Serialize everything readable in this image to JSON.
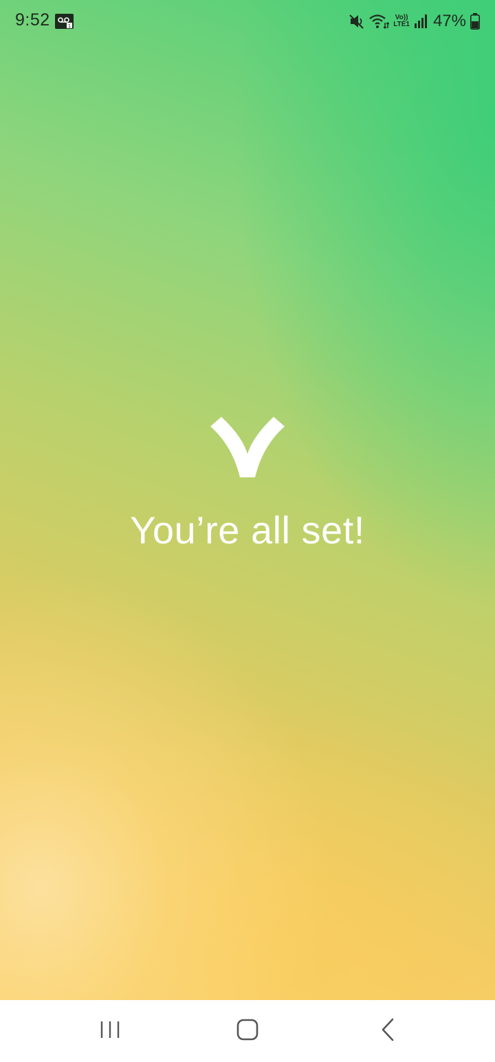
{
  "status_bar": {
    "time": "9:52",
    "volte_top": "Vo))",
    "volte_bottom": "LTE1",
    "battery_percent": "47%",
    "icons": [
      "voicemail-icon",
      "mute-icon",
      "wifi-icon",
      "volte-icon",
      "signal-icon",
      "battery-icon"
    ]
  },
  "main": {
    "logo_icon": "checkmark-v-icon",
    "title": "You’re all set!"
  },
  "nav_bar": {
    "icons": [
      "recents-icon",
      "home-icon",
      "back-icon"
    ]
  },
  "colors": {
    "gradient_green": "#4ccf78",
    "gradient_yellow": "#fbd173",
    "text": "#ffffff",
    "nav_icon": "#555555"
  }
}
